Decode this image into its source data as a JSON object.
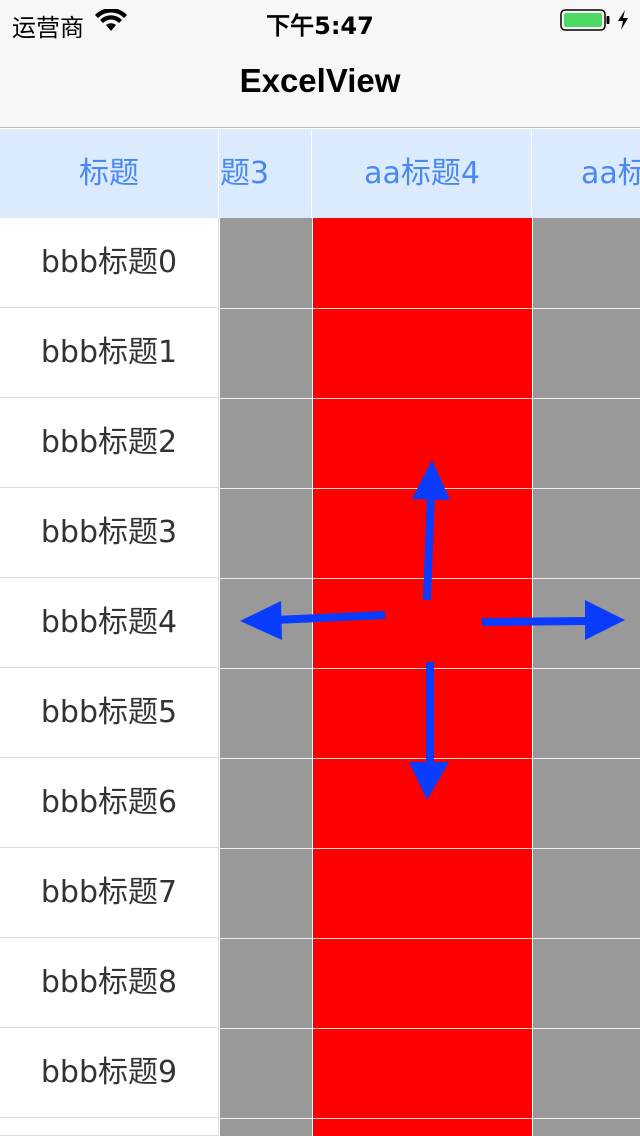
{
  "status_bar": {
    "carrier": "运营商",
    "time": "下午5:47"
  },
  "nav": {
    "title": "ExcelView"
  },
  "header": {
    "fixed": "标题",
    "col3": "题3",
    "col4": "aa标题4",
    "col5": "aa标"
  },
  "rows": [
    "bbb标题0",
    "bbb标题1",
    "bbb标题2",
    "bbb标题3",
    "bbb标题4",
    "bbb标题5",
    "bbb标题6",
    "bbb标题7",
    "bbb标题8",
    "bbb标题9"
  ],
  "colors": {
    "header_bg": "#dbeafd",
    "header_text": "#4a8af0",
    "grey_cell": "#999999",
    "red_cell": "#ff0000",
    "arrow": "#0a3cff"
  },
  "icons": [
    "wifi-icon",
    "battery-icon",
    "charging-bolt-icon",
    "arrow-up-icon",
    "arrow-down-icon",
    "arrow-left-icon",
    "arrow-right-icon"
  ]
}
